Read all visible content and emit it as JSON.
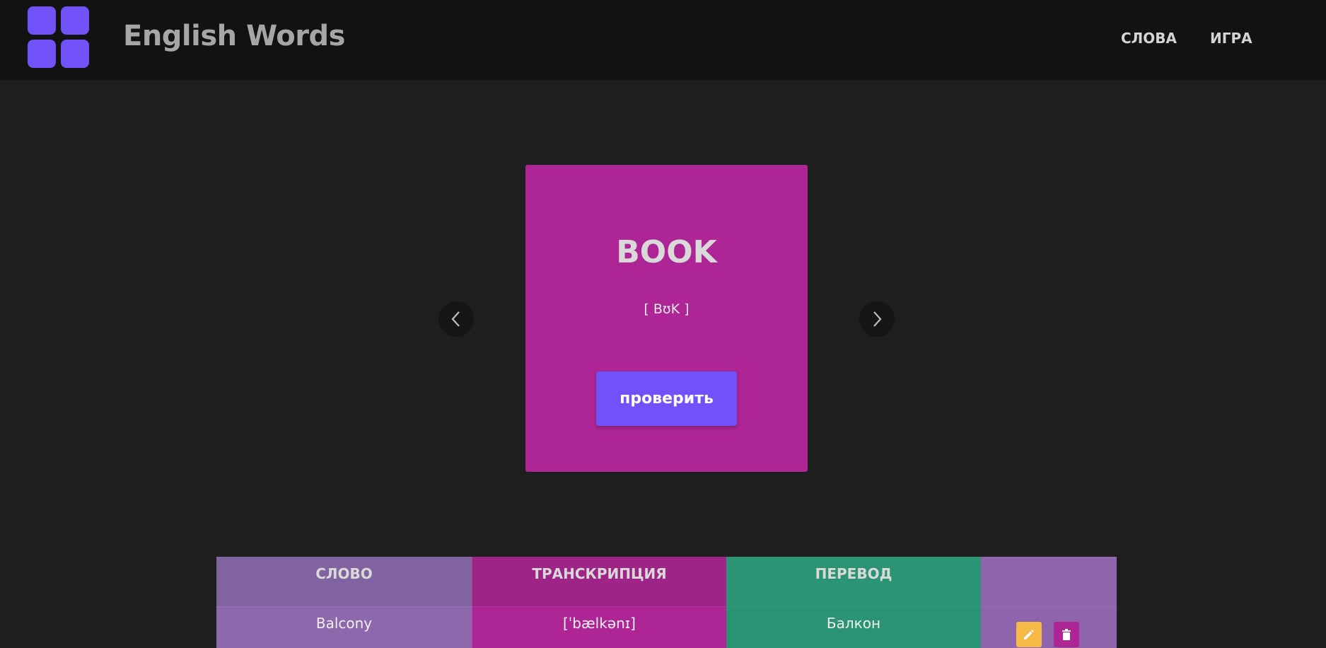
{
  "app": {
    "title": "English Words"
  },
  "nav": {
    "words": "СЛОВА",
    "game": "ИГРА"
  },
  "card": {
    "word": "BOOK",
    "transcription": "[ BʊK ]",
    "check_label": "проверить"
  },
  "table": {
    "headers": [
      "СЛОВО",
      "ТРАНСКРИПЦИЯ",
      "ПЕРЕВОД",
      ""
    ],
    "rows": [
      {
        "word": "Balcony",
        "transcription": "[ˈbælkənɪ]",
        "translation": "Балкон"
      }
    ]
  },
  "icons": {
    "logo": "grid-logo-icon",
    "prev": "chevron-left-icon",
    "next": "chevron-right-icon",
    "edit": "pencil-icon",
    "delete": "trash-icon"
  },
  "colors": {
    "accent": "#7151f8",
    "card": "#ae2696",
    "translation_column": "#2b9474",
    "edit": "#f7b946"
  }
}
